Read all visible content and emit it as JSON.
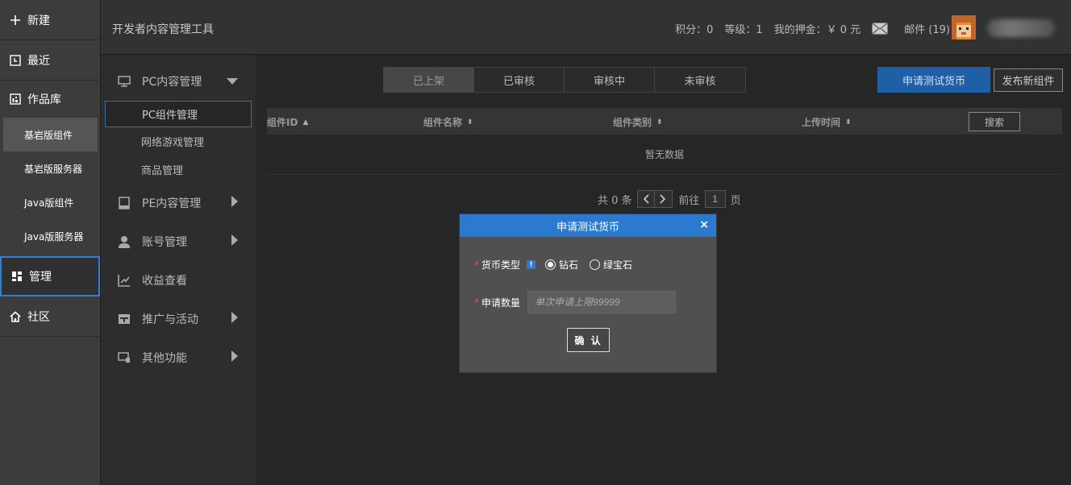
{
  "leftnav": {
    "new_label": "新建",
    "recent_label": "最近",
    "library_label": "作品库",
    "library_subs": [
      "基岩版组件",
      "基岩版服务器",
      "Java版组件",
      "Java版服务器"
    ],
    "manage_label": "管理",
    "community_label": "社区"
  },
  "header": {
    "title": "开发者内容管理工具",
    "points": "积分：0",
    "level": "等级：1",
    "deposit": "我的押金：￥ 0 元",
    "mail": "邮件 (19)"
  },
  "secnav": {
    "pc_label": "PC内容管理",
    "pc_subs": [
      "PC组件管理",
      "网络游戏管理",
      "商品管理"
    ],
    "pe_label": "PE内容管理",
    "account_label": "账号管理",
    "revenue_label": "收益查看",
    "promo_label": "推广与活动",
    "other_label": "其他功能"
  },
  "main": {
    "tabs": [
      "已上架",
      "已审核",
      "审核中",
      "未审核"
    ],
    "apply_label": "申请测试货币",
    "publish_label": "发布新组件",
    "columns": [
      "组件ID",
      "组件名称",
      "组件类别",
      "上传时间"
    ],
    "search_label": "搜索",
    "empty_text": "暂无数据",
    "pager": {
      "total": "共 0 条",
      "goto": "前往",
      "page": "1",
      "page_unit": "页"
    }
  },
  "modal": {
    "title": "申请测试货币",
    "close": "×",
    "currency_label": "货币类型",
    "info_mark": "!",
    "options": [
      "钻石",
      "绿宝石"
    ],
    "selected": "钻石",
    "amount_label": "申请数量",
    "amount_placeholder": "单次申请上限99999",
    "confirm_label": "确 认"
  },
  "colors": {
    "accent": "#2b7ad0",
    "apply_button": "#1e5fa8",
    "required": "#e05050"
  }
}
